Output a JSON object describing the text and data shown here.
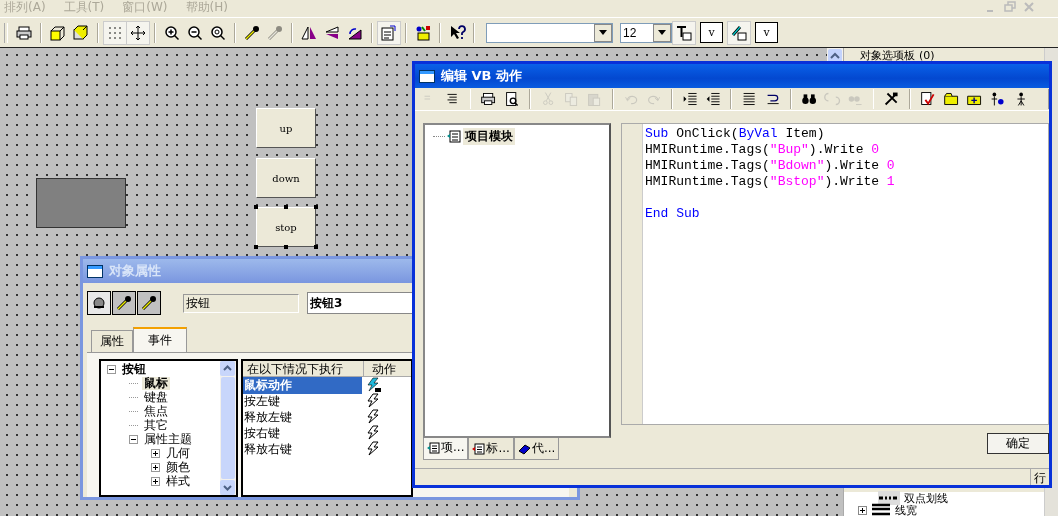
{
  "menubar": {
    "items": [
      {
        "label": "排列(A)",
        "disabled": true
      },
      {
        "label": "工具(T)",
        "disabled": true
      },
      {
        "label": "窗口(W)",
        "disabled": true
      },
      {
        "label": "帮助(H)",
        "disabled": true
      }
    ]
  },
  "toolbar": {
    "grid_shown": true,
    "snap_to_grid": true,
    "properties_shown": true,
    "paste_format_enabled": false,
    "font_size": "12",
    "text_color_button": "v",
    "line_color_button": "v"
  },
  "canvas": {
    "buttons": [
      {
        "label": "up",
        "selected": false
      },
      {
        "label": "down",
        "selected": false
      },
      {
        "label": "stop",
        "selected": true
      }
    ]
  },
  "side_panel": {
    "title": "对象选项板 (0)",
    "items": [
      {
        "label": "双点划线"
      },
      {
        "label": "线宽",
        "expanded": false
      }
    ]
  },
  "properties_window": {
    "title": "对象属性",
    "active": false,
    "object_type": "按钮",
    "object_name": "按钮3",
    "tabs": [
      {
        "label": "属性",
        "selected": false
      },
      {
        "label": "事件",
        "selected": true
      }
    ],
    "tree": [
      {
        "label": "按钮",
        "selected": false,
        "expanded": true,
        "children": [
          {
            "label": "鼠标",
            "selected": true
          },
          {
            "label": "键盘",
            "selected": false
          },
          {
            "label": "焦点",
            "selected": false
          },
          {
            "label": "其它",
            "selected": false
          },
          {
            "label": "属性主题",
            "selected": false,
            "expanded": true,
            "children": [
              {
                "label": "几何",
                "selected": false,
                "expanded": false
              },
              {
                "label": "颜色",
                "selected": false,
                "expanded": false
              },
              {
                "label": "样式",
                "selected": false,
                "expanded": false
              }
            ]
          }
        ]
      }
    ],
    "events": {
      "columns": [
        "在以下情况下执行",
        "动作"
      ],
      "rows": [
        {
          "label": "鼠标动作",
          "selected": true,
          "kind": "vb"
        },
        {
          "label": "按左键",
          "selected": false,
          "kind": "none"
        },
        {
          "label": "释放左键",
          "selected": false,
          "kind": "none"
        },
        {
          "label": "按右键",
          "selected": false,
          "kind": "none"
        },
        {
          "label": "释放右键",
          "selected": false,
          "kind": "none"
        }
      ]
    }
  },
  "vb_editor": {
    "title": "编辑 VB 动作",
    "active": true,
    "clipboard_enabled": false,
    "undo_enabled": false,
    "module_tree": [
      {
        "label": "项目模块"
      }
    ],
    "code_blocks": [
      [
        [
          {
            "kind": "keyword",
            "text": "Sub"
          },
          {
            "kind": "plain",
            "text": " OnClick("
          },
          {
            "kind": "keyword",
            "text": "ByVal"
          },
          {
            "kind": "plain",
            "text": " Item)"
          }
        ],
        [
          {
            "kind": "plain",
            "text": "HMIRuntime.Tags("
          },
          {
            "kind": "string",
            "text": "\"Bup\""
          },
          {
            "kind": "plain",
            "text": ").Write "
          },
          {
            "kind": "number",
            "text": "0"
          }
        ],
        [
          {
            "kind": "plain",
            "text": "HMIRuntime.Tags("
          },
          {
            "kind": "string",
            "text": "\"Bdown\""
          },
          {
            "kind": "plain",
            "text": ").Write "
          },
          {
            "kind": "number",
            "text": "0"
          }
        ],
        [
          {
            "kind": "plain",
            "text": "HMIRuntime.Tags("
          },
          {
            "kind": "string",
            "text": "\"Bstop\""
          },
          {
            "kind": "plain",
            "text": ").Write "
          },
          {
            "kind": "number",
            "text": "1"
          }
        ]
      ],
      [
        [
          {
            "kind": "keyword",
            "text": "End Sub"
          }
        ]
      ]
    ],
    "tabs": [
      {
        "label": "项...",
        "selected": true
      },
      {
        "label": "标...",
        "selected": false
      },
      {
        "label": "代...",
        "selected": false
      }
    ],
    "ok_button": "确定",
    "status": "行"
  }
}
